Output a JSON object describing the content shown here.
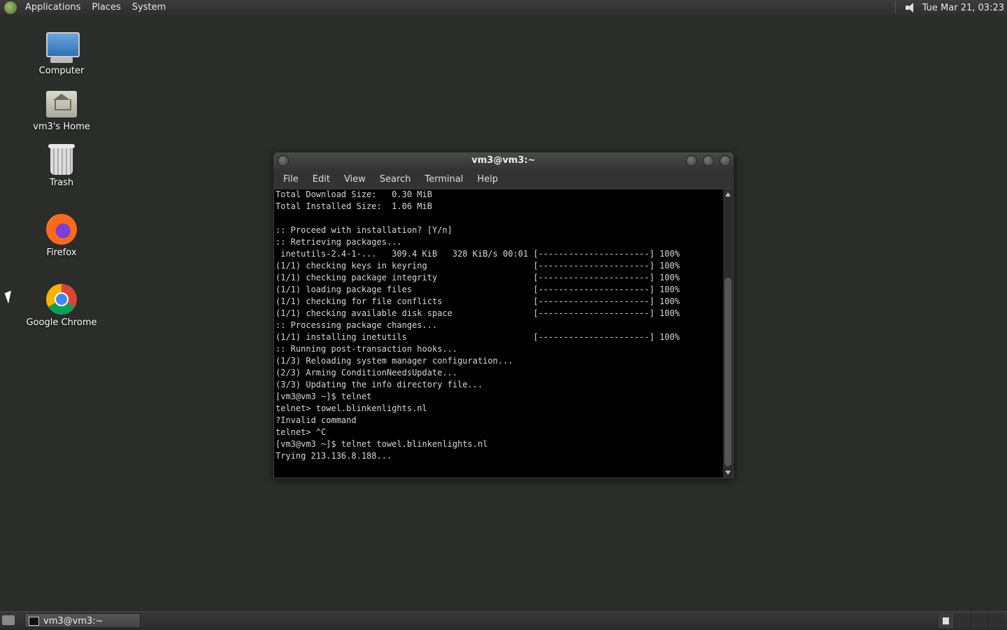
{
  "top_panel": {
    "menus": [
      "Applications",
      "Places",
      "System"
    ],
    "clock": "Tue Mar 21, 03:23"
  },
  "desktop": {
    "icons": [
      {
        "label": "Computer",
        "icon": "computer-icon"
      },
      {
        "label": "vm3's Home",
        "icon": "home-folder-icon"
      },
      {
        "label": "Trash",
        "icon": "trash-icon"
      },
      {
        "label": "Firefox",
        "icon": "firefox-icon"
      },
      {
        "label": "Google Chrome",
        "icon": "chrome-icon"
      }
    ]
  },
  "terminal": {
    "title": "vm3@vm3:~",
    "menus": [
      "File",
      "Edit",
      "View",
      "Search",
      "Terminal",
      "Help"
    ],
    "lines": [
      "Total Download Size:   0.30 MiB",
      "Total Installed Size:  1.06 MiB",
      "",
      ":: Proceed with installation? [Y/n]",
      ":: Retrieving packages...",
      " inetutils-2.4-1-...   309.4 KiB   328 KiB/s 00:01 [----------------------] 100%",
      "(1/1) checking keys in keyring                     [----------------------] 100%",
      "(1/1) checking package integrity                   [----------------------] 100%",
      "(1/1) loading package files                        [----------------------] 100%",
      "(1/1) checking for file conflicts                  [----------------------] 100%",
      "(1/1) checking available disk space                [----------------------] 100%",
      ":: Processing package changes...",
      "(1/1) installing inetutils                         [----------------------] 100%",
      ":: Running post-transaction hooks...",
      "(1/3) Reloading system manager configuration...",
      "(2/3) Arming ConditionNeedsUpdate...",
      "(3/3) Updating the info directory file...",
      "[vm3@vm3 ~]$ telnet",
      "telnet> towel.blinkenlights.nl",
      "?Invalid command",
      "telnet> ^C",
      "[vm3@vm3 ~]$ telnet towel.blinkenlights.nl",
      "Trying 213.136.8.188..."
    ]
  },
  "taskbar": {
    "task_label": "vm3@vm3:~"
  }
}
